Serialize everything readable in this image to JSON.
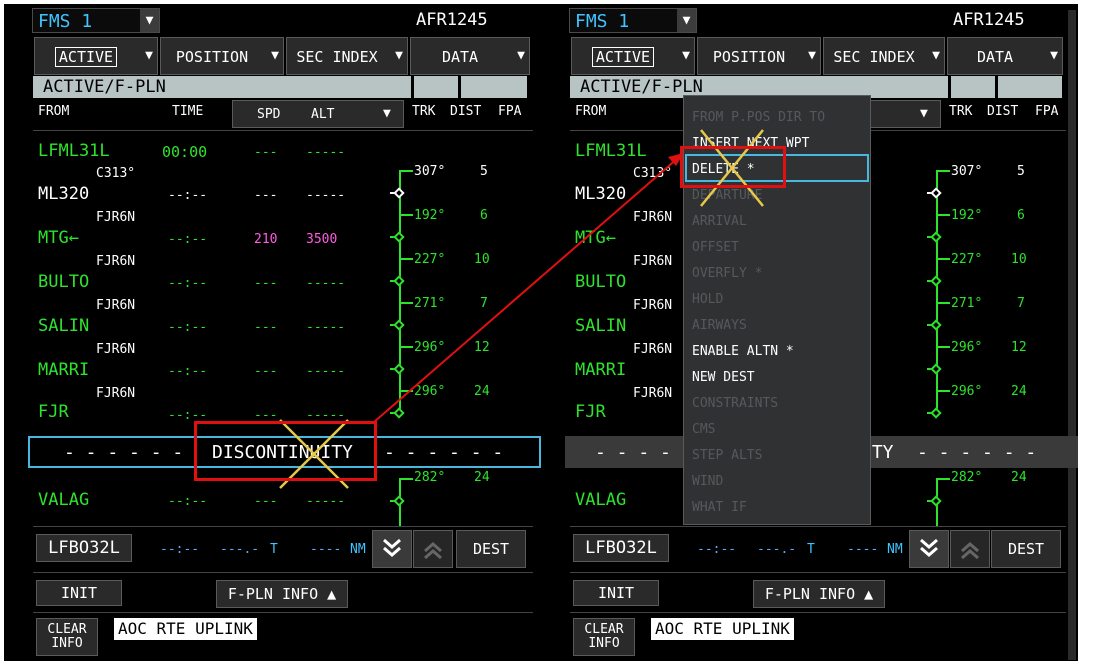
{
  "colors": {
    "green": "#2ee32e",
    "white": "#ffffff",
    "magenta": "#ff5ce1",
    "cyan": "#40c4ff",
    "title_bar": "#b8c3c3",
    "highlight": "#49b8e0",
    "annotation_red": "#e01010",
    "annotation_x": "#e8c84a"
  },
  "fms": {
    "label": "FMS 1",
    "arrow_icon": "triangle-down-icon"
  },
  "flight_id": "AFR1245",
  "tabs": [
    {
      "label": "ACTIVE"
    },
    {
      "label": "POSITION"
    },
    {
      "label": "SEC INDEX"
    },
    {
      "label": "DATA"
    }
  ],
  "page_title": "ACTIVE/F-PLN",
  "columns": {
    "from": "FROM",
    "time": "TIME",
    "spd": "SPD",
    "alt": "ALT",
    "trk": "TRK",
    "dist": "DIST",
    "fpa": "FPA"
  },
  "origin": {
    "name": "LFML31L",
    "time": "00:00",
    "spd": "---",
    "alt": "-----"
  },
  "legs": [
    {
      "via": "C313°",
      "wpt": "ML320",
      "time": "--:--",
      "spd": "---",
      "alt": "-----",
      "trk": "307°",
      "dist": "5"
    },
    {
      "via": "FJR6N",
      "wpt": "MTG←",
      "time": "--:--",
      "spd": "210",
      "alt": "3500",
      "trk": "192°",
      "dist": "6"
    },
    {
      "via": "FJR6N",
      "wpt": "BULTO",
      "time": "--:--",
      "spd": "---",
      "alt": "-----",
      "trk": "227°",
      "dist": "10"
    },
    {
      "via": "FJR6N",
      "wpt": "SALIN",
      "time": "--:--",
      "spd": "---",
      "alt": "-----",
      "trk": "271°",
      "dist": "7"
    },
    {
      "via": "FJR6N",
      "wpt": "MARRI",
      "time": "--:--",
      "spd": "---",
      "alt": "-----",
      "trk": "296°",
      "dist": "12"
    },
    {
      "via": "FJR6N",
      "wpt": "FJR",
      "time": "--:--",
      "spd": "---",
      "alt": "-----",
      "trk": "296°",
      "dist": "24"
    }
  ],
  "discontinuity": {
    "dashes_left": "- - - - - -",
    "label": "DISCONTINUITY",
    "dashes_right": "- - - - - -",
    "partial_label": "ITY",
    "partial_dashes_left": "- - - -",
    "partial_dashes_right": "- - - - - -"
  },
  "after_disc": {
    "wpt": "VALAG",
    "time": "--:--",
    "spd": "---",
    "alt": "-----",
    "trk": "282°",
    "dist": "24"
  },
  "bottom": {
    "dest_name": "LFBO32L",
    "time": "--:--",
    "efob": "---.-",
    "efob_unit": "T",
    "dist": "----",
    "dist_unit": "NM",
    "dest_button": "DEST",
    "init": "INIT",
    "fpln_info": "F-PLN INFO",
    "clear_info_line1": "CLEAR",
    "clear_info_line2": "INFO",
    "aoc": "AOC RTE UPLINK"
  },
  "menu_items": [
    {
      "label": "FROM P.POS DIR TO",
      "enabled": false
    },
    {
      "label": "INSERT NEXT WPT",
      "enabled": true
    },
    {
      "label": "DELETE *",
      "enabled": true
    },
    {
      "label": "DEPARTURE",
      "enabled": false
    },
    {
      "label": "ARRIVAL",
      "enabled": false
    },
    {
      "label": "OFFSET",
      "enabled": false
    },
    {
      "label": "OVERFLY *",
      "enabled": false
    },
    {
      "label": "HOLD",
      "enabled": false
    },
    {
      "label": "AIRWAYS",
      "enabled": false
    },
    {
      "label": "ENABLE ALTN *",
      "enabled": true
    },
    {
      "label": "NEW DEST",
      "enabled": true
    },
    {
      "label": "CONSTRAINTS",
      "enabled": false
    },
    {
      "label": "CMS",
      "enabled": false
    },
    {
      "label": "STEP ALTS",
      "enabled": false
    },
    {
      "label": "WIND",
      "enabled": false
    },
    {
      "label": "WHAT IF",
      "enabled": false
    }
  ]
}
